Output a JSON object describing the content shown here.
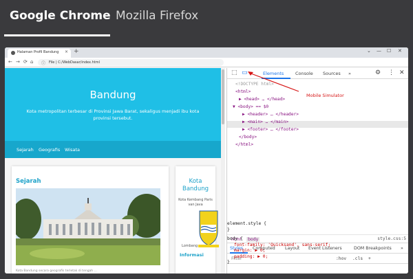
{
  "outer_tabs": [
    {
      "label": "Google Chrome",
      "active": true
    },
    {
      "label": "Mozilla Firefox",
      "active": false
    }
  ],
  "browser": {
    "tab_title": "Halaman Profil Bandung",
    "tab_close": "×",
    "new_tab": "+",
    "window_controls": [
      "⌄",
      "—",
      "☐",
      "✕"
    ],
    "nav": {
      "back": "←",
      "forward": "→",
      "reload": "⟳",
      "home": "⌂"
    },
    "url_info_icon": "ⓘ",
    "url": "File | C:/WebDasar/index.html"
  },
  "page": {
    "hero_title": "Bandung",
    "hero_subtitle": "Kota metropolitan terbesar di Provinsi Jawa Barat, sekaligus menjadi ibu kota provinsi tersebut.",
    "nav": [
      "Sejarah",
      "Geografis",
      "Wisata"
    ],
    "card_main": {
      "heading": "Sejarah",
      "tail_text": "Kota Bandung secara geografis terletak di tengah ..."
    },
    "card_side": {
      "heading": "Kota Bandung",
      "sub": "Kota Kembang Paris van Java",
      "lombang": "Lombang",
      "info": "Informasi"
    }
  },
  "devtools": {
    "tabs": [
      "Elements",
      "Console",
      "Sources",
      "»"
    ],
    "icons": [
      "inspect-icon",
      "device-toolbar-icon",
      "gear-icon",
      "more-icon",
      "close-icon"
    ],
    "dom": [
      {
        "text": "<!DOCTYPE html>",
        "kind": "comment"
      },
      {
        "text": "<html>",
        "kind": "tag"
      },
      {
        "text": "▶ <head> … </head>",
        "kind": "tag"
      },
      {
        "text": "▼ <body> == $0",
        "kind": "tag"
      },
      {
        "text": "▶ <header> … </header>",
        "kind": "tag"
      },
      {
        "text": "▶ <main> … </main>",
        "kind": "tag"
      },
      {
        "text": "▶ <footer> … </footer>",
        "kind": "tag"
      },
      {
        "text": "</body>",
        "kind": "tag"
      },
      {
        "text": "</html>",
        "kind": "tag"
      }
    ],
    "annotation": "Mobile Simulator",
    "crumbs": [
      "html",
      "body"
    ],
    "style_tabs": [
      "Styles",
      "Computed",
      "Layout",
      "Event Listeners",
      "DOM Breakpoints",
      "»"
    ],
    "filter_placeholder": "Filter",
    "filter_buttons": [
      ":hov",
      ".cls",
      "+"
    ],
    "rules": [
      {
        "selector": "element.style {",
        "close": "}"
      },
      {
        "selector": "body {",
        "source": "style.css:5",
        "props": [
          "font-family: 'Quicksand', sans-serif;",
          "margin: ▶ 0;",
          "padding: ▶ 0;"
        ],
        "close": "}"
      }
    ]
  }
}
